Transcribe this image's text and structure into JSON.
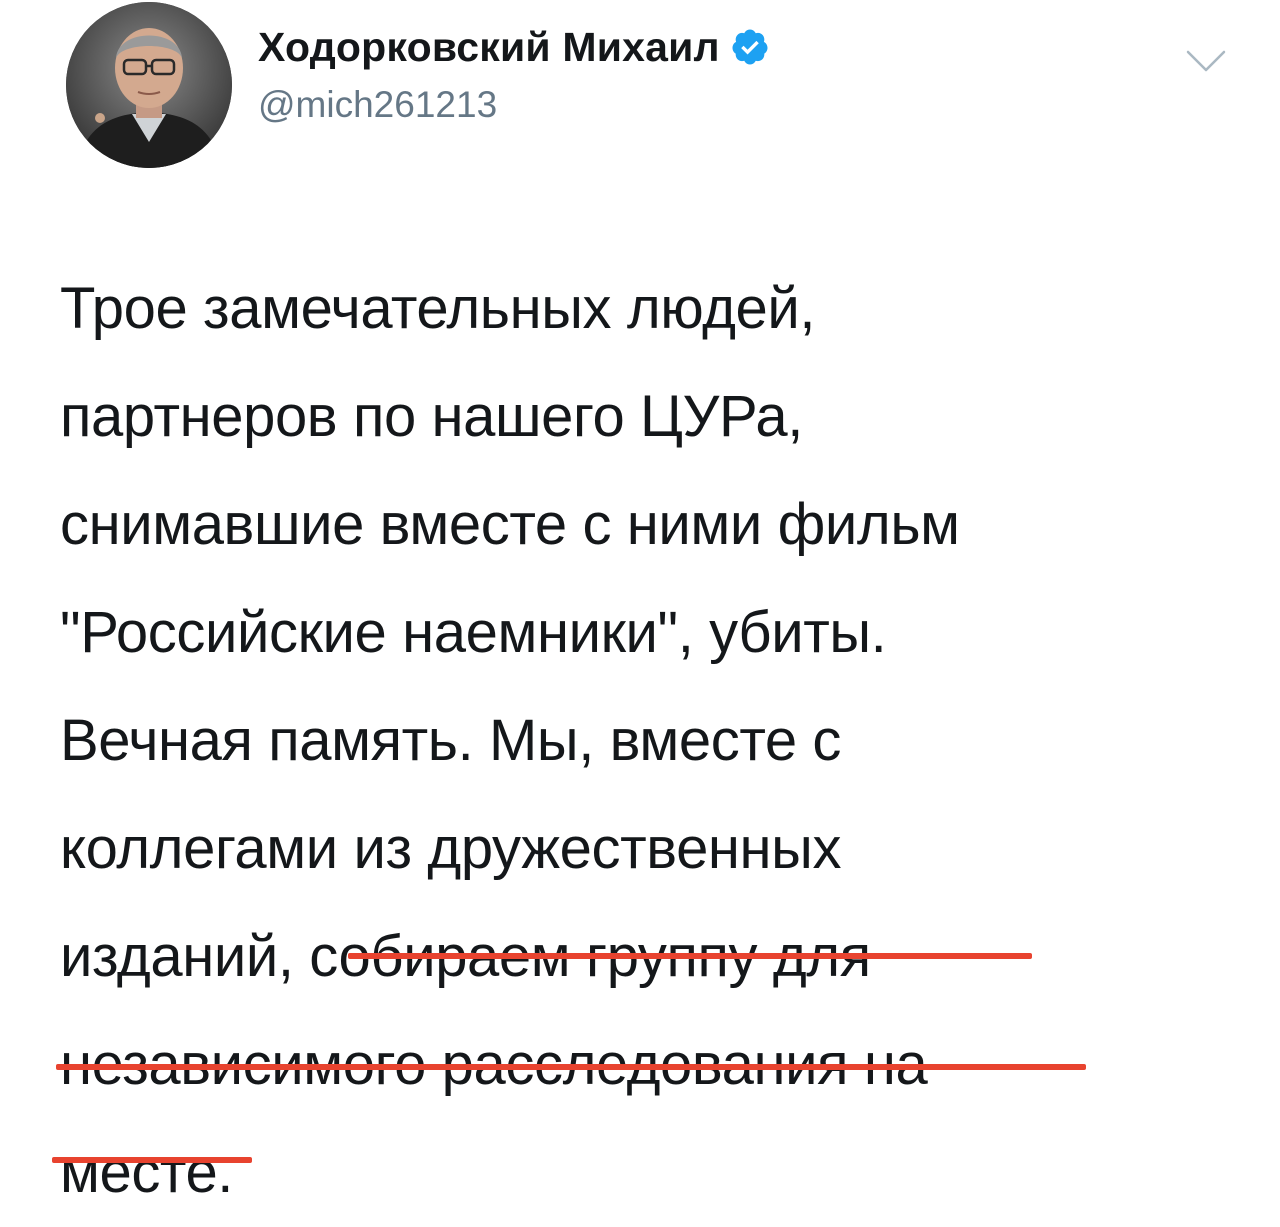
{
  "tweet": {
    "author": {
      "display_name": "Ходорковский Михаил",
      "handle": "@mich261213",
      "verified_icon": "verified-badge-icon",
      "avatar_icon": "avatar-photo"
    },
    "menu_icon": "chevron-down-icon",
    "text_lines": [
      "Трое замечательных людей,",
      "партнеров по нашего ЦУРа,",
      "снимавшие вместе с ними фильм",
      "\"Российские наемники\", убиты.",
      "Вечная память. Мы, вместе с",
      "коллегами из дружественных",
      "изданий, собираем группу для",
      "независимого расследования на",
      "месте."
    ]
  },
  "colors": {
    "text": "#14171a",
    "handle": "#657786",
    "verified": "#1da1f2",
    "underline": "#e8432f"
  }
}
